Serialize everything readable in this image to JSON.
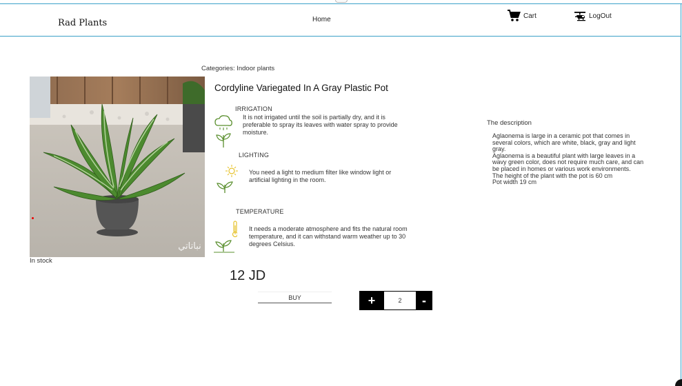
{
  "header": {
    "brand": "Rad Plants",
    "home_label": "Home",
    "cart_label": "Cart",
    "logout_label": "LogOut"
  },
  "product": {
    "categories": "Categories: Indoor plants",
    "title": "Cordyline Variegated In A Gray Plastic Pot",
    "stock": "In stock",
    "price": "12 JD",
    "image_watermark": "نباتاتي",
    "care": {
      "irrigation": {
        "heading": "IRRIGATION",
        "text": "It is not irrigated until the soil is partially dry, and it is preferable to spray its leaves with water spray to provide moisture."
      },
      "lighting": {
        "heading": "LIGHTING",
        "text": "You need a light to medium filter like window light or artificial lighting in the room."
      },
      "temperature": {
        "heading": "TEMPERATURE",
        "text": "It needs a moderate atmosphere and fits the natural room temperature, and it can withstand warm weather up to 30 degrees Celsius."
      }
    },
    "buy_label": "BUY",
    "plus_label": "+",
    "minus_label": "-",
    "quantity": "2"
  },
  "description": {
    "heading": "The description",
    "lines": [
      "Aglaonema is large in a ceramic pot that comes in several colors, which are white, black, gray and light gray.",
      "Aglaonema is a beautiful plant with large leaves in a wavy green color, does not require much care, and can be placed in homes or various work environments.",
      "The height of the plant with the pot is 60 cm",
      "Pot width 19 cm"
    ]
  },
  "colors": {
    "accent_border": "#3aa0c8",
    "icon_green": "#5a8f2e",
    "icon_yellow": "#e6c22a",
    "stepper_bg": "#000000"
  },
  "icons": {
    "cart": "shopping-cart-icon",
    "logout": "helicopter-icon",
    "irrigation": "rain-cloud-sprout-icon",
    "lighting": "sun-sprout-icon",
    "temperature": "thermometer-sprout-icon"
  }
}
